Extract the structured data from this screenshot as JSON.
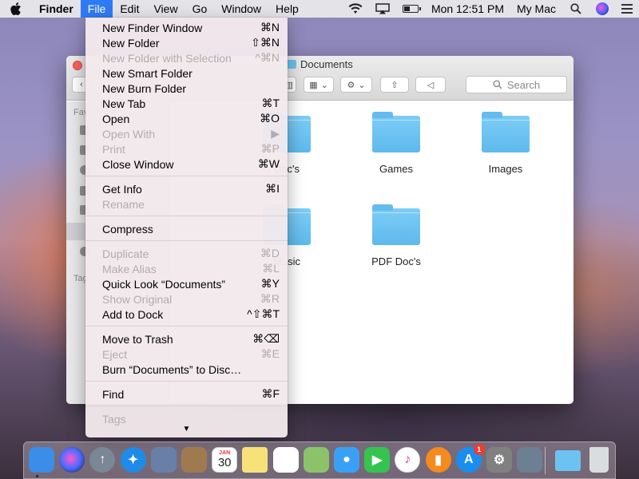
{
  "menubar": {
    "app_name": "Finder",
    "items": [
      "File",
      "Edit",
      "View",
      "Go",
      "Window",
      "Help"
    ],
    "clock": "Mon 12:51 PM",
    "user": "My Mac"
  },
  "window": {
    "title": "Documents",
    "search_placeholder": "Search",
    "sidebar": {
      "favorites_label": "Fav",
      "tags_label": "Tag"
    },
    "items": [
      "Doc's",
      "Games",
      "Images",
      "Music",
      "PDF Doc's"
    ]
  },
  "file_menu": {
    "groups": [
      [
        {
          "label": "New Finder Window",
          "shortcut": "⌘N",
          "enabled": true
        },
        {
          "label": "New Folder",
          "shortcut": "⇧⌘N",
          "enabled": true
        },
        {
          "label": "New Folder with Selection",
          "shortcut": "^⌘N",
          "enabled": false
        },
        {
          "label": "New Smart Folder",
          "shortcut": "",
          "enabled": true
        },
        {
          "label": "New Burn Folder",
          "shortcut": "",
          "enabled": true
        },
        {
          "label": "New Tab",
          "shortcut": "⌘T",
          "enabled": true
        },
        {
          "label": "Open",
          "shortcut": "⌘O",
          "enabled": true
        },
        {
          "label": "Open With",
          "shortcut": "▶",
          "enabled": false
        },
        {
          "label": "Print",
          "shortcut": "⌘P",
          "enabled": false
        },
        {
          "label": "Close Window",
          "shortcut": "⌘W",
          "enabled": true
        }
      ],
      [
        {
          "label": "Get Info",
          "shortcut": "⌘I",
          "enabled": true
        },
        {
          "label": "Rename",
          "shortcut": "",
          "enabled": false
        }
      ],
      [
        {
          "label": "Compress",
          "shortcut": "",
          "enabled": true
        }
      ],
      [
        {
          "label": "Duplicate",
          "shortcut": "⌘D",
          "enabled": false
        },
        {
          "label": "Make Alias",
          "shortcut": "⌘L",
          "enabled": false
        },
        {
          "label": "Quick Look “Documents”",
          "shortcut": "⌘Y",
          "enabled": true
        },
        {
          "label": "Show Original",
          "shortcut": "⌘R",
          "enabled": false
        },
        {
          "label": "Add to Dock",
          "shortcut": "^⇧⌘T",
          "enabled": true
        }
      ],
      [
        {
          "label": "Move to Trash",
          "shortcut": "⌘⌫",
          "enabled": true
        },
        {
          "label": "Eject",
          "shortcut": "⌘E",
          "enabled": false
        },
        {
          "label": "Burn “Documents” to Disc…",
          "shortcut": "",
          "enabled": true
        }
      ],
      [
        {
          "label": "Find",
          "shortcut": "⌘F",
          "enabled": true
        }
      ],
      [
        {
          "label": "Tags",
          "shortcut": "",
          "enabled": false
        }
      ]
    ],
    "more_indicator": "▼"
  },
  "dock": {
    "calendar_month": "JAN",
    "calendar_day": "30",
    "app_store_badge": "1",
    "apps": [
      {
        "name": "finder-icon",
        "color": "#3b8de8"
      },
      {
        "name": "siri-icon",
        "color": "#2b2b6b"
      },
      {
        "name": "launchpad-icon",
        "color": "#7a8794"
      },
      {
        "name": "safari-icon",
        "color": "#1f8be9"
      },
      {
        "name": "mail-icon",
        "color": "#6a7fa8"
      },
      {
        "name": "contacts-icon",
        "color": "#a07a4f"
      },
      {
        "name": "calendar-icon",
        "color": "#ffffff"
      },
      {
        "name": "notes-icon",
        "color": "#f7e27a"
      },
      {
        "name": "reminders-icon",
        "color": "#ffffff"
      },
      {
        "name": "maps-icon",
        "color": "#8cc36a"
      },
      {
        "name": "messages-icon",
        "color": "#3aa0f6"
      },
      {
        "name": "facetime-icon",
        "color": "#35c44f"
      },
      {
        "name": "itunes-icon",
        "color": "#ffffff"
      },
      {
        "name": "ibooks-icon",
        "color": "#f58a1e"
      },
      {
        "name": "app-store-icon",
        "color": "#1a8ef0"
      },
      {
        "name": "system-preferences-icon",
        "color": "#808080"
      },
      {
        "name": "preview-icon",
        "color": "#6d7f92"
      },
      {
        "name": "downloads-folder-icon",
        "color": "#6cc3f2"
      },
      {
        "name": "trash-icon",
        "color": "#d9dde0"
      }
    ]
  }
}
